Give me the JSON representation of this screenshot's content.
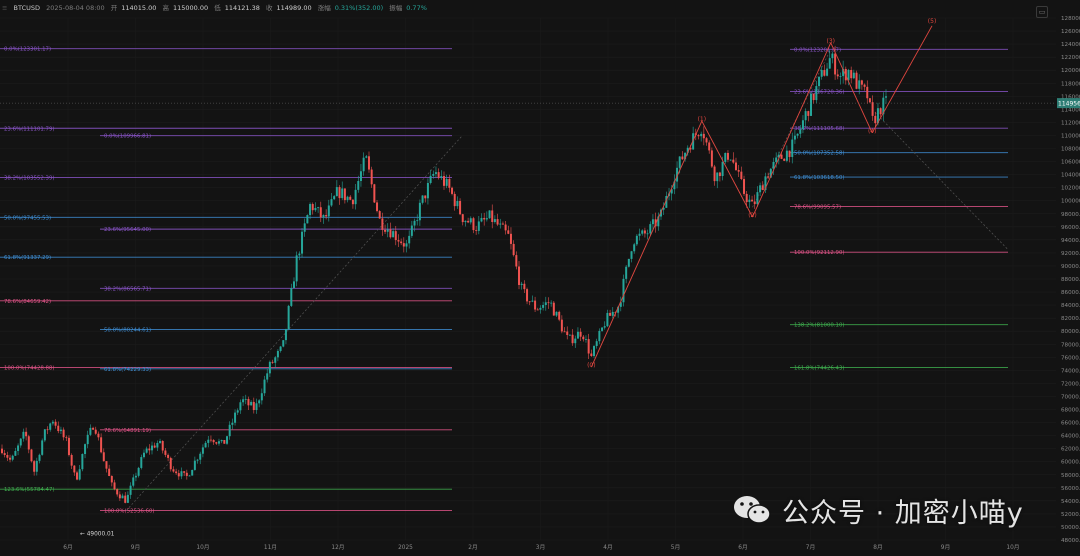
{
  "header": {
    "symbol": "BTCUSD",
    "date": "2025-08-04 08:00",
    "open_label": "开",
    "open": "114015.00",
    "high_label": "高",
    "high": "115000.00",
    "low_label": "低",
    "low": "114121.38",
    "close_label": "收",
    "close": "114989.00",
    "change_label": "涨幅",
    "change": "0.31%(352.00)",
    "amp_label": "振幅",
    "amp": "0.77%"
  },
  "watermark": {
    "text": "公众号 · 加密小喵y"
  },
  "chart_data": {
    "type": "candlestick",
    "symbol": "BTCUSD",
    "ylim": [
      48000,
      128000
    ],
    "y_ticks": [
      48000,
      50000,
      52000,
      54000,
      56000,
      58000,
      60000,
      62000,
      64000,
      66000,
      68000,
      70000,
      72000,
      74000,
      76000,
      78000,
      80000,
      82000,
      84000,
      86000,
      88000,
      90000,
      92000,
      94000,
      96000,
      98000,
      100000,
      102000,
      104000,
      106000,
      108000,
      110000,
      112000,
      114000,
      116000,
      118000,
      120000,
      122000,
      124000,
      126000,
      128000
    ],
    "x_ticks": [
      "6月",
      "9月",
      "10月",
      "11月",
      "12月",
      "2025",
      "2月",
      "3月",
      "4月",
      "5月",
      "6月",
      "7月",
      "8月",
      "9月",
      "10月"
    ],
    "last_price": "114956.0",
    "colors": {
      "up": "#26a69a",
      "down": "#ef5350",
      "wave": "#e0463f",
      "grid": "#1c1c1c"
    },
    "price_path": [
      [
        0,
        62000
      ],
      [
        2,
        60000
      ],
      [
        5,
        64500
      ],
      [
        7,
        58500
      ],
      [
        9,
        64000
      ],
      [
        11,
        66500
      ],
      [
        14,
        63000
      ],
      [
        16,
        57000
      ],
      [
        18,
        62500
      ],
      [
        20,
        66000
      ],
      [
        22,
        60500
      ],
      [
        24,
        56000
      ],
      [
        27,
        54000
      ],
      [
        29,
        58000
      ],
      [
        31,
        61500
      ],
      [
        34,
        63000
      ],
      [
        37,
        59000
      ],
      [
        40,
        57500
      ],
      [
        43,
        61500
      ],
      [
        45,
        64000
      ],
      [
        48,
        62500
      ],
      [
        52,
        69500
      ],
      [
        55,
        68000
      ],
      [
        58,
        74500
      ],
      [
        61,
        77500
      ],
      [
        64,
        91000
      ],
      [
        67,
        99500
      ],
      [
        70,
        97000
      ],
      [
        73,
        101500
      ],
      [
        76,
        100000
      ],
      [
        79,
        106500
      ],
      [
        82,
        97000
      ],
      [
        85,
        95000
      ],
      [
        88,
        93000
      ],
      [
        91,
        99500
      ],
      [
        94,
        104500
      ],
      [
        97,
        102000
      ],
      [
        100,
        97500
      ],
      [
        103,
        96000
      ],
      [
        106,
        97500
      ],
      [
        110,
        94500
      ],
      [
        113,
        86000
      ],
      [
        116,
        83500
      ],
      [
        119,
        84500
      ],
      [
        123,
        78500
      ],
      [
        126,
        80000
      ],
      [
        128,
        76000
      ],
      [
        131,
        81500
      ],
      [
        134,
        84000
      ],
      [
        137,
        94000
      ],
      [
        140,
        95000
      ],
      [
        143,
        97500
      ],
      [
        146,
        104000
      ],
      [
        149,
        108500
      ],
      [
        152,
        111500
      ],
      [
        155,
        103500
      ],
      [
        158,
        107500
      ],
      [
        161,
        101500
      ],
      [
        163,
        99000
      ],
      [
        166,
        104000
      ],
      [
        169,
        106500
      ],
      [
        172,
        108500
      ],
      [
        175,
        114000
      ],
      [
        178,
        119000
      ],
      [
        180,
        122000
      ],
      [
        182,
        119000
      ],
      [
        184,
        120000
      ],
      [
        186,
        117500
      ],
      [
        188,
        116000
      ],
      [
        189,
        112000
      ],
      [
        191,
        114500
      ],
      [
        192,
        114956
      ]
    ],
    "x_domain": [
      0,
      192
    ],
    "lows": [
      {
        "label": "49000.01",
        "value": 49000.01
      }
    ],
    "fib_levels": [
      {
        "label": "0.0%(123301.17)",
        "value": 123301.17,
        "color": "#8b55c9",
        "span": "full"
      },
      {
        "label": "23.6%(111101.79)",
        "value": 111101.79,
        "color": "#8b55c9",
        "span": "full"
      },
      {
        "label": "38.2%(103552.39)",
        "value": 103552.39,
        "color": "#8b55c9",
        "span": "full"
      },
      {
        "label": "50.0%(97455.53)",
        "value": 97455.53,
        "color": "#3f8fd6",
        "span": "full"
      },
      {
        "label": "61.8%(91337.29)",
        "value": 91337.29,
        "color": "#3f8fd6",
        "span": "full"
      },
      {
        "label": "78.6%(84659.42)",
        "value": 84659.42,
        "color": "#e3558a",
        "span": "full"
      },
      {
        "label": "100.0%(74428.88)",
        "value": 74428.88,
        "color": "#e3558a",
        "span": "full"
      },
      {
        "label": "123.6%(55784.47)",
        "value": 55784.47,
        "color": "#3fb04f",
        "span": "full"
      },
      {
        "label": "0.0%(109966.81)",
        "value": 109966.81,
        "color": "#8b55c9",
        "span": "mid"
      },
      {
        "label": "23.6%(95645.00)",
        "value": 95645.0,
        "color": "#8b55c9",
        "span": "mid"
      },
      {
        "label": "38.2%(86565.71)",
        "value": 86565.71,
        "color": "#8b55c9",
        "span": "mid"
      },
      {
        "label": "50.0%(80244.61)",
        "value": 80244.61,
        "color": "#3f8fd6",
        "span": "mid"
      },
      {
        "label": "61.8%(74229.33)",
        "value": 74229.33,
        "color": "#3f8fd6",
        "span": "mid"
      },
      {
        "label": "78.6%(64891.19)",
        "value": 64891.19,
        "color": "#e3558a",
        "span": "mid"
      },
      {
        "label": "100.0%(52536.60)",
        "value": 52536.6,
        "color": "#e3558a",
        "span": "mid"
      },
      {
        "label": "0.0%(123201.07)",
        "value": 123201.07,
        "color": "#8b55c9",
        "span": "right"
      },
      {
        "label": "23.6%(116720.36)",
        "value": 116720.36,
        "color": "#8b55c9",
        "span": "right"
      },
      {
        "label": "38.2%(111105.68)",
        "value": 111105.68,
        "color": "#8b55c9",
        "span": "right"
      },
      {
        "label": "50.0%(107352.58)",
        "value": 107352.58,
        "color": "#3f8fd6",
        "span": "right"
      },
      {
        "label": "61.8%(103618.50)",
        "value": 103618.5,
        "color": "#3f8fd6",
        "span": "right"
      },
      {
        "label": "78.6%(99095.57)",
        "value": 99095.57,
        "color": "#e3558a",
        "span": "right"
      },
      {
        "label": "100.0%(92112.90)",
        "value": 92112.9,
        "color": "#e3558a",
        "span": "right"
      },
      {
        "label": "138.2%(81000.10)",
        "value": 81000.1,
        "color": "#3fb04f",
        "span": "right"
      },
      {
        "label": "161.8%(74426.43)",
        "value": 74426.43,
        "color": "#3fb04f",
        "span": "right"
      }
    ],
    "wave_labels": [
      {
        "label": "(0)",
        "x": 128,
        "value": 74500
      },
      {
        "label": "(1)",
        "x": 152,
        "value": 112200
      },
      {
        "label": "(2)",
        "x": 163,
        "value": 97500
      },
      {
        "label": "(3)",
        "x": 180,
        "value": 124200
      },
      {
        "label": "(4)",
        "x": 189,
        "value": 110400
      },
      {
        "label": "(5)",
        "x": 202,
        "value": 127200
      }
    ]
  }
}
